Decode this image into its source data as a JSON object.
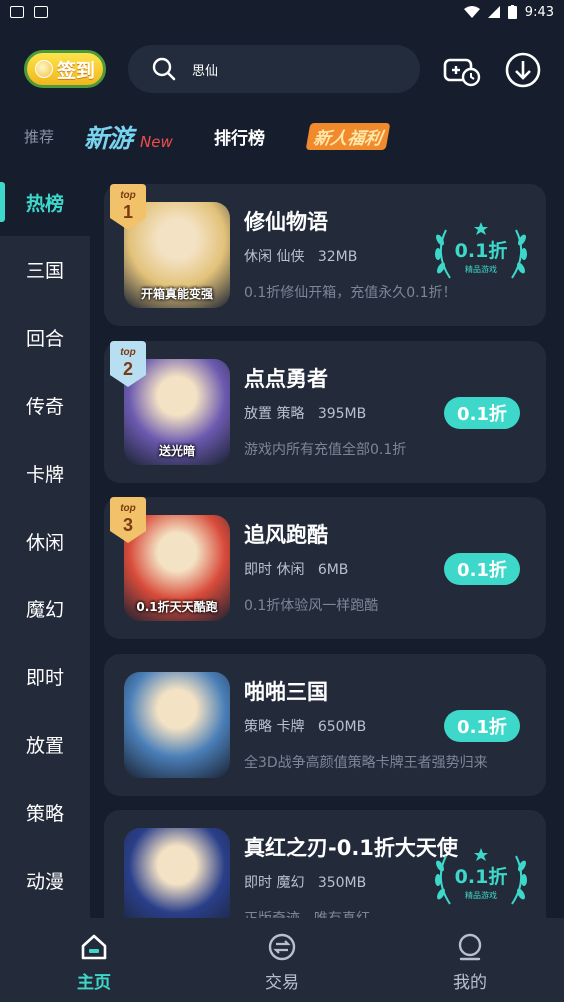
{
  "status_bar": {
    "time": "9:43"
  },
  "header": {
    "signin_label": "签到",
    "search_text": "思仙"
  },
  "top_tabs": {
    "recommend": "推荐",
    "new_games": "新游",
    "new_games_en": "New",
    "ranking": "排行榜",
    "newbie_benefits": "新人福利"
  },
  "sidebar": {
    "items": [
      {
        "label": "热榜",
        "active": true
      },
      {
        "label": "三国",
        "active": false
      },
      {
        "label": "回合",
        "active": false
      },
      {
        "label": "传奇",
        "active": false
      },
      {
        "label": "卡牌",
        "active": false
      },
      {
        "label": "休闲",
        "active": false
      },
      {
        "label": "魔幻",
        "active": false
      },
      {
        "label": "即时",
        "active": false
      },
      {
        "label": "放置",
        "active": false
      },
      {
        "label": "策略",
        "active": false
      },
      {
        "label": "动漫",
        "active": false
      }
    ]
  },
  "games": [
    {
      "name": "修仙物语",
      "tags": "休闲 仙侠",
      "size": "32MB",
      "desc": "0.1折修仙开箱，充值永久0.1折！",
      "badge_style": "laurel",
      "discount": "0.1折",
      "badge_sub": "精品游戏",
      "rank": "1",
      "rank_top": "top",
      "thumb_caption": "开箱真能变强",
      "accent": "#e2c27a"
    },
    {
      "name": "点点勇者",
      "tags": "放置 策略",
      "size": "395MB",
      "desc": "游戏内所有充值全部0.1折",
      "badge_style": "pill",
      "discount": "0.1折",
      "rank": "2",
      "rank_top": "top",
      "thumb_caption": "送光暗",
      "accent": "#6c5ab0"
    },
    {
      "name": "追风跑酷",
      "tags": "即时 休闲",
      "size": "6MB",
      "desc": "0.1折体验风一样跑酷",
      "badge_style": "pill",
      "discount": "0.1折",
      "rank": "3",
      "rank_top": "top",
      "thumb_caption": "0.1折天天酷跑",
      "accent": "#d84b3a"
    },
    {
      "name": "啪啪三国",
      "tags": "策略 卡牌",
      "size": "650MB",
      "desc": "全3D战争高颜值策略卡牌王者强势归来",
      "badge_style": "pill",
      "discount": "0.1折",
      "rank": "",
      "rank_top": "",
      "thumb_caption": "",
      "accent": "#4a7fb8"
    },
    {
      "name": "真红之刃-0.1折大天使",
      "tags": "即时 魔幻",
      "size": "350MB",
      "desc": "正版奇迹，唯有真红",
      "badge_style": "laurel",
      "discount": "0.1折",
      "badge_sub": "精品游戏",
      "rank": "",
      "rank_top": "",
      "thumb_caption": "",
      "accent": "#2a3f8a"
    }
  ],
  "bottom_nav": {
    "items": [
      {
        "label": "主页",
        "icon": "home-icon",
        "active": true
      },
      {
        "label": "交易",
        "icon": "exchange-icon",
        "active": false
      },
      {
        "label": "我的",
        "icon": "profile-icon",
        "active": false
      }
    ]
  },
  "colors": {
    "accent": "#3dd8c9",
    "background": "#161e2e",
    "card": "#232b3b"
  }
}
